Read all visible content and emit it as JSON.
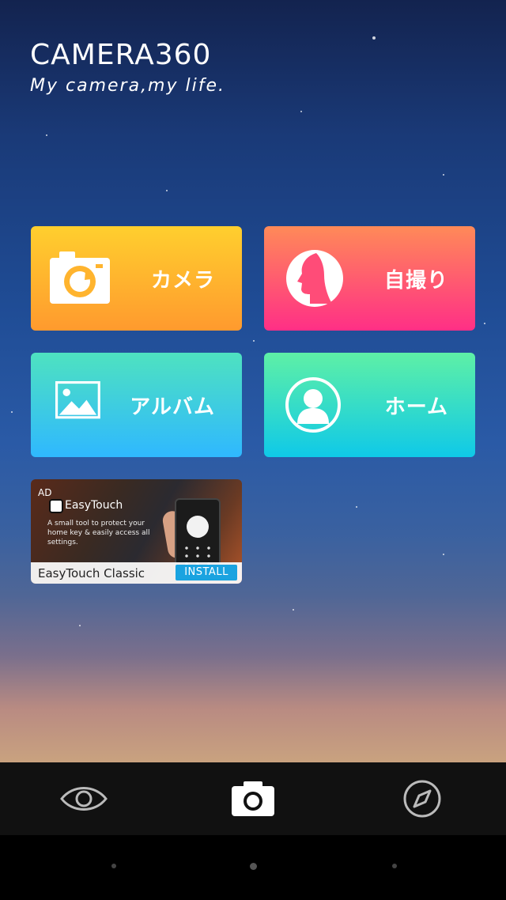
{
  "brand": {
    "title": "CAMERA360",
    "tagline": "My camera,my life."
  },
  "tiles": [
    {
      "label": "カメラ",
      "icon": "camera-icon"
    },
    {
      "label": "自撮り",
      "icon": "selfie-face-icon"
    },
    {
      "label": "アルバム",
      "icon": "album-image-icon"
    },
    {
      "label": "ホーム",
      "icon": "profile-person-icon"
    }
  ],
  "ad": {
    "badge": "AD",
    "app_name": "EasyTouch",
    "description": "A small tool to protect your home key & easily access all settings.",
    "title": "EasyTouch Classic",
    "install_label": "INSTALL"
  },
  "toolbar": {
    "items": [
      {
        "icon": "eye-icon"
      },
      {
        "icon": "camera-icon"
      },
      {
        "icon": "compass-icon"
      }
    ]
  },
  "colors": {
    "camera_tile": "#ff9a2e",
    "selfie_tile": "#ff2f86",
    "album_tile": "#2fb8ff",
    "home_tile": "#0fc9e8",
    "install_button": "#1aa3e0"
  }
}
